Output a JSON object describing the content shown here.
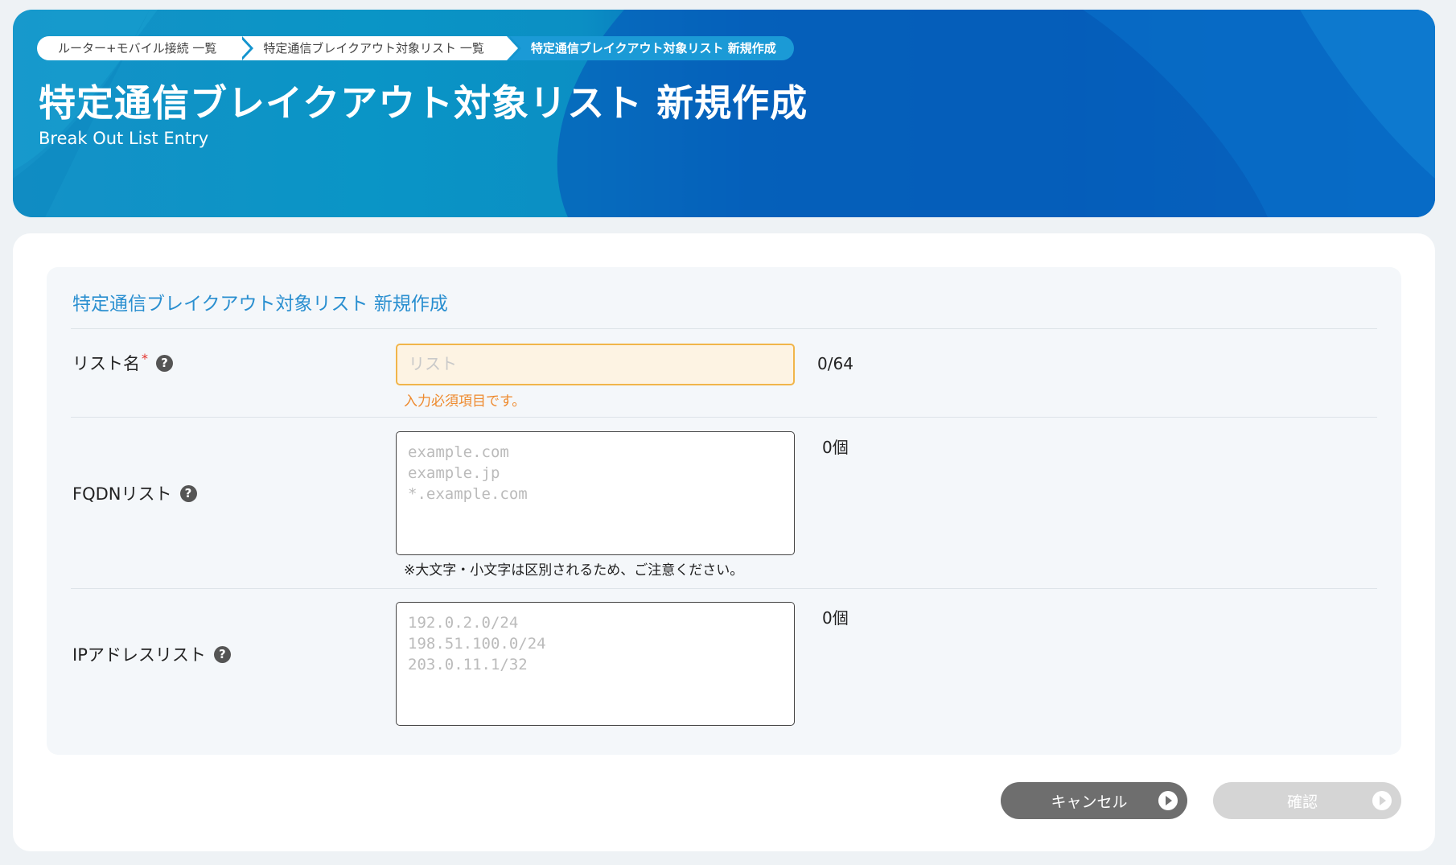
{
  "breadcrumb": {
    "items": [
      {
        "label": "ルーター+モバイル接続 一覧"
      },
      {
        "label": "特定通信ブレイクアウト対象リスト 一覧"
      },
      {
        "label": "特定通信ブレイクアウト対象リスト 新規作成"
      }
    ]
  },
  "header": {
    "title": "特定通信ブレイクアウト対象リスト 新規作成",
    "subtitle": "Break Out List Entry"
  },
  "form": {
    "section_title": "特定通信ブレイクアウト対象リスト 新規作成",
    "list_name": {
      "label": "リスト名",
      "required_mark": "*",
      "help_icon": "?",
      "value": "",
      "placeholder": "リスト",
      "counter": "0/64",
      "error": "入力必須項目です。"
    },
    "fqdn_list": {
      "label": "FQDNリスト",
      "help_icon": "?",
      "value": "",
      "placeholder": "example.com\nexample.jp\n*.example.com",
      "counter": "0個",
      "note": "※大文字・小文字は区別されるため、ご注意ください。"
    },
    "ip_list": {
      "label": "IPアドレスリスト",
      "help_icon": "?",
      "value": "",
      "placeholder": "192.0.2.0/24\n198.51.100.0/24\n203.0.11.1/32",
      "counter": "0個"
    }
  },
  "actions": {
    "cancel_label": "キャンセル",
    "confirm_label": "確認"
  },
  "colors": {
    "accent": "#2a8fd0",
    "error": "#ee8a2e",
    "required": "#e4322b",
    "cancel_button": "#6e6e6e",
    "confirm_button_disabled": "#d5d5d5"
  }
}
